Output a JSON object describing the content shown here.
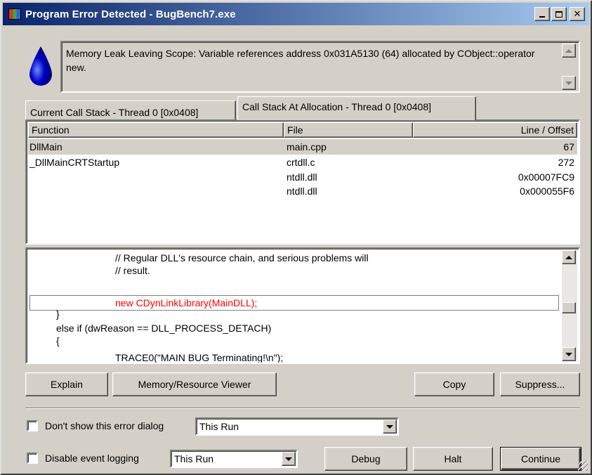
{
  "window": {
    "title": "Program Error Detected - BugBench7.exe"
  },
  "message": "Memory Leak Leaving Scope: Variable  references address 0x031A5130 (64) allocated by CObject::operator new.",
  "tabs": [
    {
      "label": "Current Call Stack - Thread 0 [0x0408]"
    },
    {
      "label": "Call Stack At Allocation - Thread 0 [0x0408]"
    }
  ],
  "table": {
    "columns": [
      "Function",
      "File",
      "Line / Offset"
    ],
    "rows": [
      {
        "function": "DllMain",
        "file": "main.cpp",
        "line": "67"
      },
      {
        "function": "_DllMainCRTStartup",
        "file": "crtdll.c",
        "line": "272"
      },
      {
        "function": "",
        "file": "ntdll.dll",
        "line": "0x00007FC9"
      },
      {
        "function": "",
        "file": "ntdll.dll",
        "line": "0x000055F6"
      }
    ]
  },
  "code": {
    "lines": [
      "// Regular DLL's resource chain, and serious problems will",
      "// result.",
      "",
      "new CDynLinkLibrary(MainDLL);",
      "}",
      "else if (dwReason == DLL_PROCESS_DETACH)",
      "{",
      "TRACE0(\"MAIN BUG Terminating!\\n\");"
    ],
    "highlight_color": "#ff0000"
  },
  "buttons": {
    "explain": "Explain",
    "memory_viewer": "Memory/Resource Viewer",
    "copy": "Copy",
    "suppress": "Suppress...",
    "debug": "Debug",
    "halt": "Halt",
    "continue": "Continue"
  },
  "options": {
    "dont_show_label": "Don't show this error dialog",
    "dont_show_value": "This Run",
    "disable_logging_label": "Disable event logging",
    "disable_logging_value": "This Run"
  },
  "colors": {
    "title_gradient_start": "#0a246a",
    "title_gradient_end": "#a6caf0",
    "face": "#d4d0c8",
    "drop_icon": "#0000c8"
  }
}
